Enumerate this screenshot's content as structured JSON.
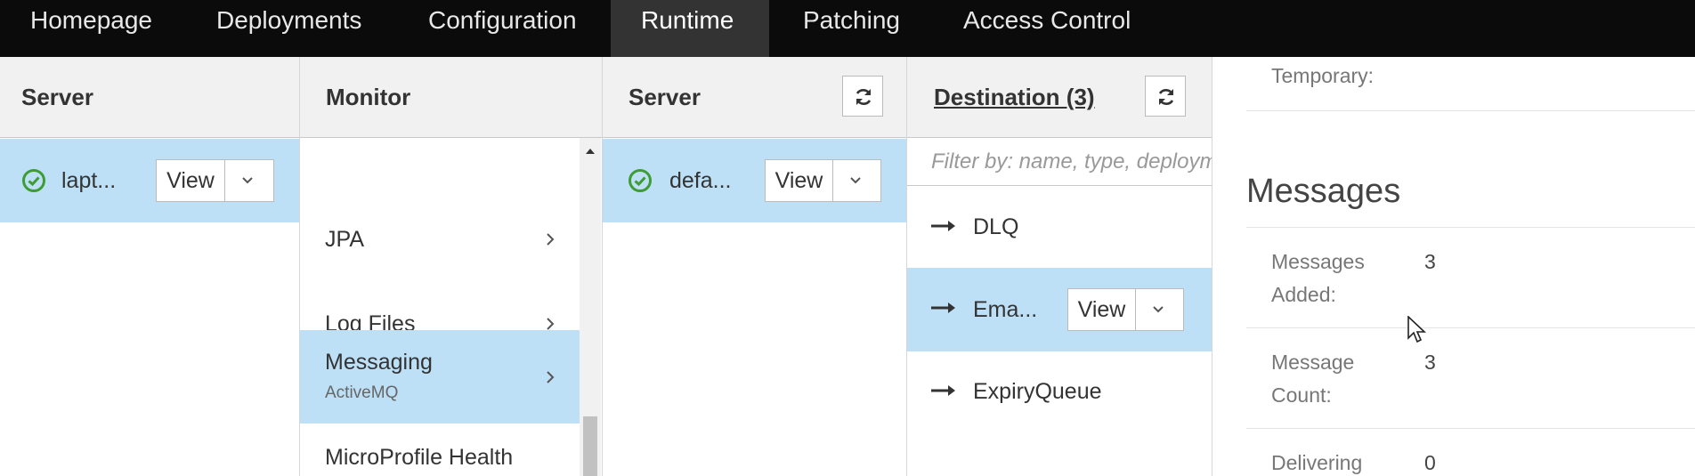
{
  "nav": {
    "tabs": [
      {
        "label": "Homepage"
      },
      {
        "label": "Deployments"
      },
      {
        "label": "Configuration"
      },
      {
        "label": "Runtime",
        "active": true
      },
      {
        "label": "Patching"
      },
      {
        "label": "Access Control"
      }
    ]
  },
  "server_col": {
    "title": "Server",
    "item": {
      "label": "lapt...",
      "status_icon": "check-circle-icon",
      "view_label": "View"
    }
  },
  "monitor_col": {
    "title": "Monitor",
    "items": [
      {
        "label": "JPA"
      },
      {
        "label": "Log Files"
      },
      {
        "label": "Messaging",
        "sublabel": "ActiveMQ",
        "selected": true
      },
      {
        "label": "MicroProfile Health"
      }
    ]
  },
  "server2_col": {
    "title": "Server",
    "item": {
      "label": "defa...",
      "status_icon": "check-circle-icon",
      "view_label": "View"
    }
  },
  "destination_col": {
    "title": "Destination (3)",
    "filter_placeholder": "Filter by: name, type, deployment",
    "items": [
      {
        "label": "DLQ"
      },
      {
        "label": "Ema...",
        "selected": true,
        "view_label": "View"
      },
      {
        "label": "ExpiryQueue"
      }
    ]
  },
  "detail": {
    "temporary_label": "Temporary:",
    "messages_title": "Messages",
    "fields": [
      {
        "key_line1": "Messages",
        "key_line2": "Added:",
        "value": "3"
      },
      {
        "key_line1": "Message",
        "key_line2": "Count:",
        "value": "3"
      },
      {
        "key_line1": "Delivering",
        "key_line2": "",
        "value": "0"
      }
    ]
  },
  "colors": {
    "nav_bg": "#0b0b0b",
    "nav_active": "#333333",
    "selected_row": "#bde0f6",
    "ok_green": "#3f9c35",
    "header_bg": "#f1f1f1"
  }
}
